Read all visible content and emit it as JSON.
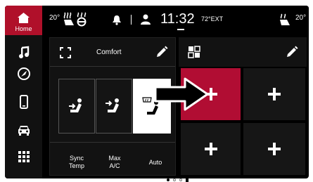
{
  "sidebar": {
    "home_label": "Home",
    "items": [
      "home-icon",
      "music-icon",
      "nav-icon",
      "phone-icon",
      "car-icon",
      "apps-icon"
    ]
  },
  "status": {
    "driver_temp": "20°",
    "time": "11:32",
    "ext_temp": "72°EXT",
    "passenger_temp": "20°"
  },
  "climate_panel": {
    "title": "Comfort",
    "controls": [
      {
        "label": "Sync\nTemp"
      },
      {
        "label": "Max\nA/C"
      },
      {
        "label": "Auto"
      }
    ]
  },
  "page_indicator": {
    "count": 3,
    "active": 2
  },
  "colors": {
    "accent": "#b10d33",
    "background": "#000000",
    "panel": "#1c1c1c"
  }
}
